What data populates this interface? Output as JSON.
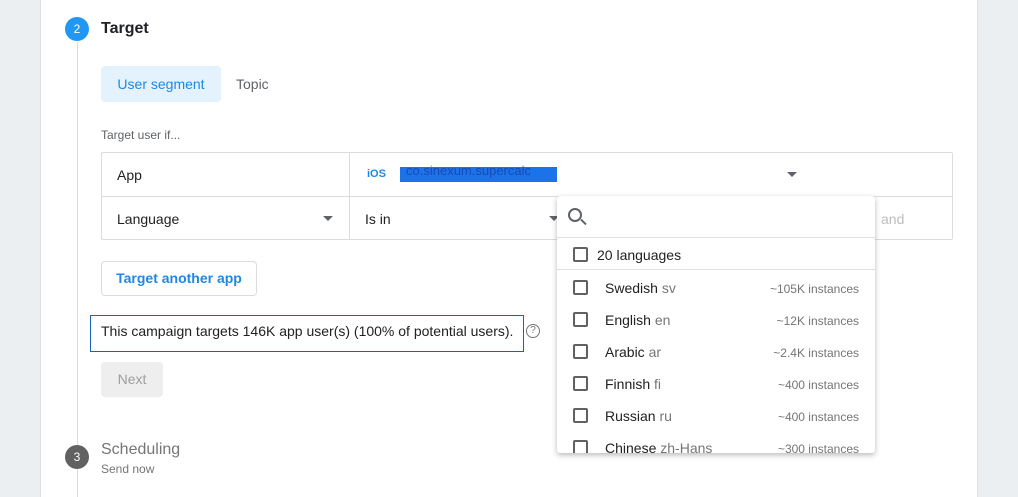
{
  "step2": {
    "number": "2",
    "title": "Target"
  },
  "tabs": {
    "user_segment": "User segment",
    "topic": "Topic"
  },
  "target_label": "Target user if...",
  "conditions": {
    "app_label": "App",
    "app_platform": "iOS",
    "app_name": "co.sinexum.supercalc",
    "language_label": "Language",
    "operator": "Is in",
    "and_label": "and"
  },
  "target_another_app": "Target another app",
  "summary": "This campaign targets 146K app user(s) (100% of potential users).",
  "help_icon": "?",
  "next_button": "Next",
  "dropdown": {
    "search_placeholder": "",
    "all_label": "20 languages",
    "languages": [
      {
        "name": "Swedish",
        "code": "sv",
        "instances": "~105K instances"
      },
      {
        "name": "English",
        "code": "en",
        "instances": "~12K instances"
      },
      {
        "name": "Arabic",
        "code": "ar",
        "instances": "~2.4K instances"
      },
      {
        "name": "Finnish",
        "code": "fi",
        "instances": "~400 instances"
      },
      {
        "name": "Russian",
        "code": "ru",
        "instances": "~400 instances"
      },
      {
        "name": "Chinese",
        "code": "zh-Hans",
        "instances": "~300 instances"
      }
    ]
  },
  "step3": {
    "number": "3",
    "title": "Scheduling",
    "subtitle": "Send now"
  },
  "colors": {
    "accent": "#1e88e5",
    "tab_bg": "#e3f2fd",
    "step_inactive": "#616161"
  }
}
